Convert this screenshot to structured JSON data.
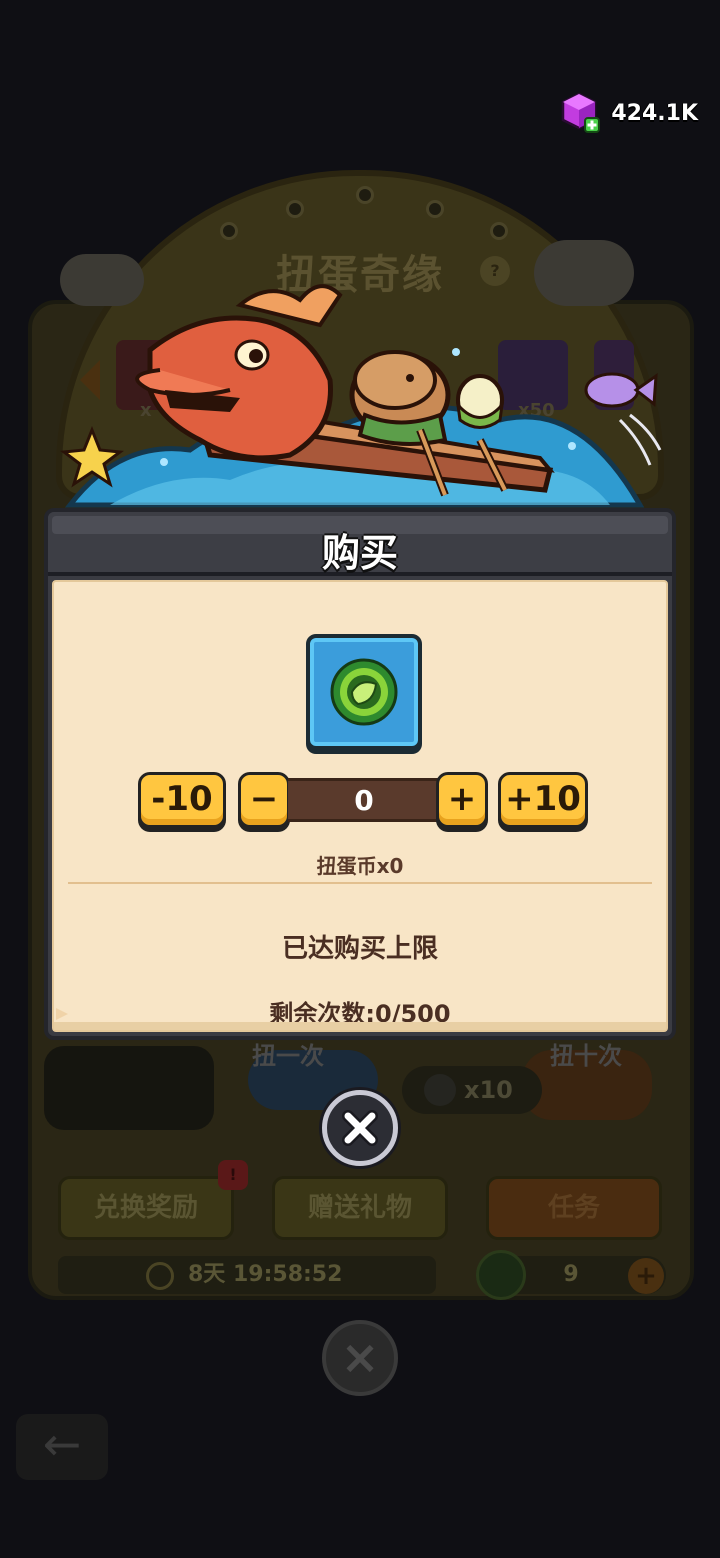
{
  "currency": {
    "gem_value": "424.1K",
    "gem_icon": "purple-gem-plus-icon"
  },
  "background": {
    "event_title": "扭蛋奇缘",
    "help_symbol": "?",
    "slot_badge_left": "x",
    "slot_badge_right": "x50",
    "pull_once_label": "扭一次",
    "pull_ten_label": "扭十次",
    "coin_cost": "x10",
    "exchange_rewards_label": "兑换奖励",
    "exchange_badge": "!",
    "send_gift_label": "赠送礼物",
    "tasks_label": "任务",
    "timer": "8天 19:58:52",
    "coin_count": "9"
  },
  "modal": {
    "title": "购买",
    "item_icon": "gacha-coin-icon",
    "minus_ten_label": "-10",
    "minus_label": "−",
    "quantity": "0",
    "plus_label": "+",
    "plus_ten_label": "+10",
    "coin_label": "扭蛋币x0",
    "limit_message": "已达购买上限",
    "remaining": "剩余次数:0/500"
  },
  "colors": {
    "modal_body": "#f8e5c6",
    "button_yellow": "#ffc640",
    "tile_blue": "#3b9ddb",
    "header_dark": "#3d3e45"
  }
}
